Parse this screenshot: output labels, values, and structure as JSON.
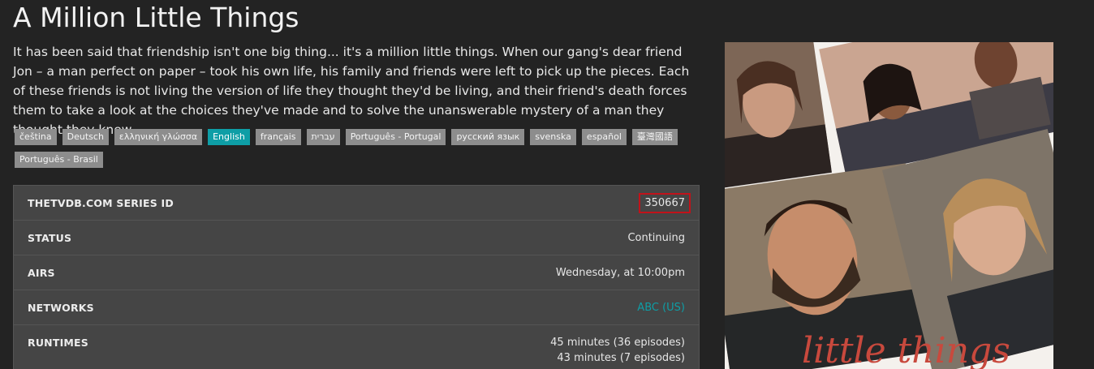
{
  "show": {
    "title": "A Million Little Things",
    "overview": "It has been said that friendship isn't one big thing... it's a million little things. When our gang's dear friend Jon – a man perfect on paper – took his own life, his family and friends were left to pick up the pieces. Each of these friends is not living the version of life they thought they'd be living, and their friend's death forces them to take a look at the choices they've made and to solve the unanswerable mystery of a man they thought they knew."
  },
  "languages": [
    {
      "label": "čeština",
      "active": false
    },
    {
      "label": "Deutsch",
      "active": false
    },
    {
      "label": "ελληνική γλώσσα",
      "active": false
    },
    {
      "label": "English",
      "active": true
    },
    {
      "label": "français",
      "active": false
    },
    {
      "label": "עברית",
      "active": false
    },
    {
      "label": "Português - Portugal",
      "active": false
    },
    {
      "label": "русский язык",
      "active": false
    },
    {
      "label": "svenska",
      "active": false
    },
    {
      "label": "español",
      "active": false
    },
    {
      "label": "臺灣國語",
      "active": false
    },
    {
      "label": "Português - Brasil",
      "active": false
    }
  ],
  "info": {
    "series_id_label": "THETVDB.COM SERIES ID",
    "series_id_value": "350667",
    "status_label": "STATUS",
    "status_value": "Continuing",
    "airs_label": "AIRS",
    "airs_value": "Wednesday, at 10:00pm",
    "networks_label": "NETWORKS",
    "networks_value": "ABC (US)",
    "runtimes_label": "RUNTIMES",
    "runtimes_values": [
      "45 minutes (36 episodes)",
      "43 minutes (7 episodes)"
    ]
  },
  "poster": {
    "title_fragment": "little things"
  },
  "colors": {
    "accent": "#0e9ea6",
    "highlight_box": "#c1121a",
    "tag_bg": "#8d8d8d",
    "panel_bg": "#454545",
    "page_bg": "#232323"
  }
}
